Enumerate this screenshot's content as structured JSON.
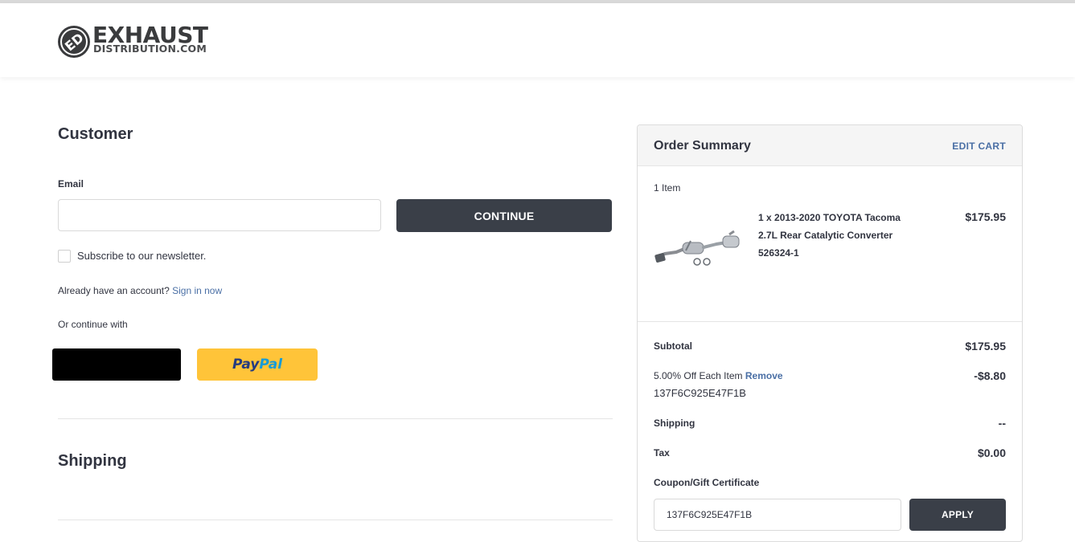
{
  "header": {
    "logo_main": "EXHAUST",
    "logo_sub": "DISTRIBUTION.COM",
    "logo_badge": "ED"
  },
  "customer": {
    "title": "Customer",
    "email_label": "Email",
    "email_value": "",
    "continue_label": "CONTINUE",
    "newsletter_label": "Subscribe to our newsletter.",
    "account_prompt": "Already have an account?",
    "sign_in_label": "Sign in now",
    "continue_with": "Or continue with",
    "paypal_part1": "Pay",
    "paypal_part2": "Pal"
  },
  "shipping": {
    "title": "Shipping"
  },
  "order_summary": {
    "title": "Order Summary",
    "edit_cart_label": "EDIT CART",
    "item_count": "1 Item",
    "item": {
      "name_line1": "1 x 2013-2020 TOYOTA Tacoma",
      "name_line2": "2.7L Rear Catalytic Converter",
      "name_line3": "526324-1",
      "price": "$175.95"
    },
    "subtotal_label": "Subtotal",
    "subtotal_value": "$175.95",
    "discount_label": "5.00% Off Each Item",
    "discount_remove": "Remove",
    "discount_value": "-$8.80",
    "discount_code": "137F6C925E47F1B",
    "shipping_label": "Shipping",
    "shipping_value": "--",
    "tax_label": "Tax",
    "tax_value": "$0.00",
    "coupon_label": "Coupon/Gift Certificate",
    "coupon_value": "137F6C925E47F1B",
    "apply_label": "APPLY"
  },
  "colors": {
    "dark_button": "#3a3f48",
    "link": "#4a6fa5",
    "paypal_yellow": "#ffc439"
  }
}
